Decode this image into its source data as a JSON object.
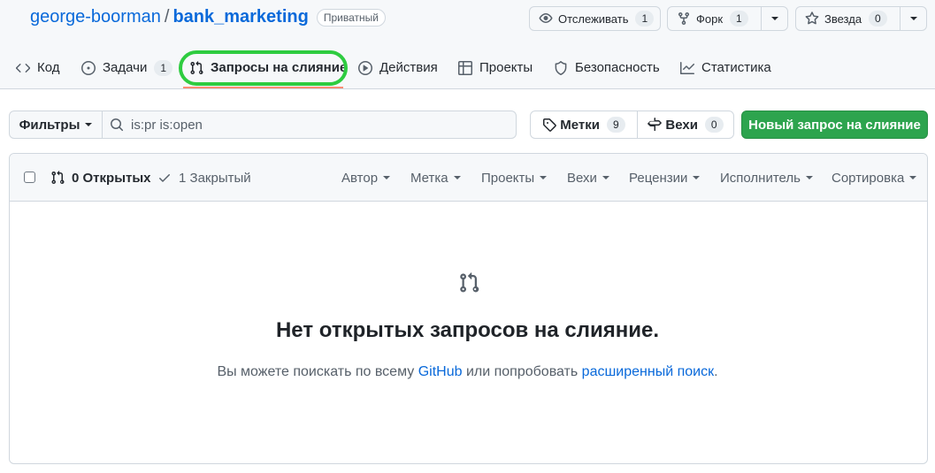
{
  "repo": {
    "owner": "george-boorman",
    "separator": "/",
    "name": "bank_marketing",
    "visibility": "Приватный"
  },
  "actions": {
    "watch": {
      "label": "Отслеживать",
      "count": "1",
      "icon": "eye-icon"
    },
    "fork": {
      "label": "Форк",
      "count": "1",
      "icon": "repo-forked-icon"
    },
    "star": {
      "label": "Звезда",
      "count": "0",
      "icon": "star-icon"
    }
  },
  "tabs": [
    {
      "label": "Код",
      "icon": "code-icon"
    },
    {
      "label": "Задачи",
      "count": "1",
      "icon": "issue-opened-icon"
    },
    {
      "label": "Запросы на слияние",
      "icon": "git-pull-request-icon",
      "active": true
    },
    {
      "label": "Действия",
      "icon": "play-icon"
    },
    {
      "label": "Проекты",
      "icon": "table-icon"
    },
    {
      "label": "Безопасность",
      "icon": "shield-icon"
    },
    {
      "label": "Статистика",
      "icon": "graph-icon"
    }
  ],
  "subnav": {
    "filters_label": "Фильтры",
    "search_value": "is:pr is:open",
    "labels": {
      "label": "Метки",
      "count": "9"
    },
    "milestones": {
      "label": "Вехи",
      "count": "0"
    },
    "new_pr_label": "Новый запрос на слияние"
  },
  "list": {
    "open_label": "0 Открытых",
    "closed_label": "1 Закрытый",
    "filters": [
      "Автор",
      "Метка",
      "Проекты",
      "Вехи",
      "Рецензии",
      "Исполнитель",
      "Сортировка"
    ]
  },
  "blankslate": {
    "title": "Нет открытых запросов на слияние.",
    "desc_before": "Вы можете поискать по всему ",
    "link_github": "GitHub",
    "desc_middle": " или попробовать ",
    "link_advanced": "расширенный поиск",
    "desc_end": "."
  },
  "colors": {
    "accent": "#0969da",
    "primary_button": "#2da44e",
    "tab_underline": "#fd8c73",
    "highlight_ring": "#2ecc40"
  }
}
